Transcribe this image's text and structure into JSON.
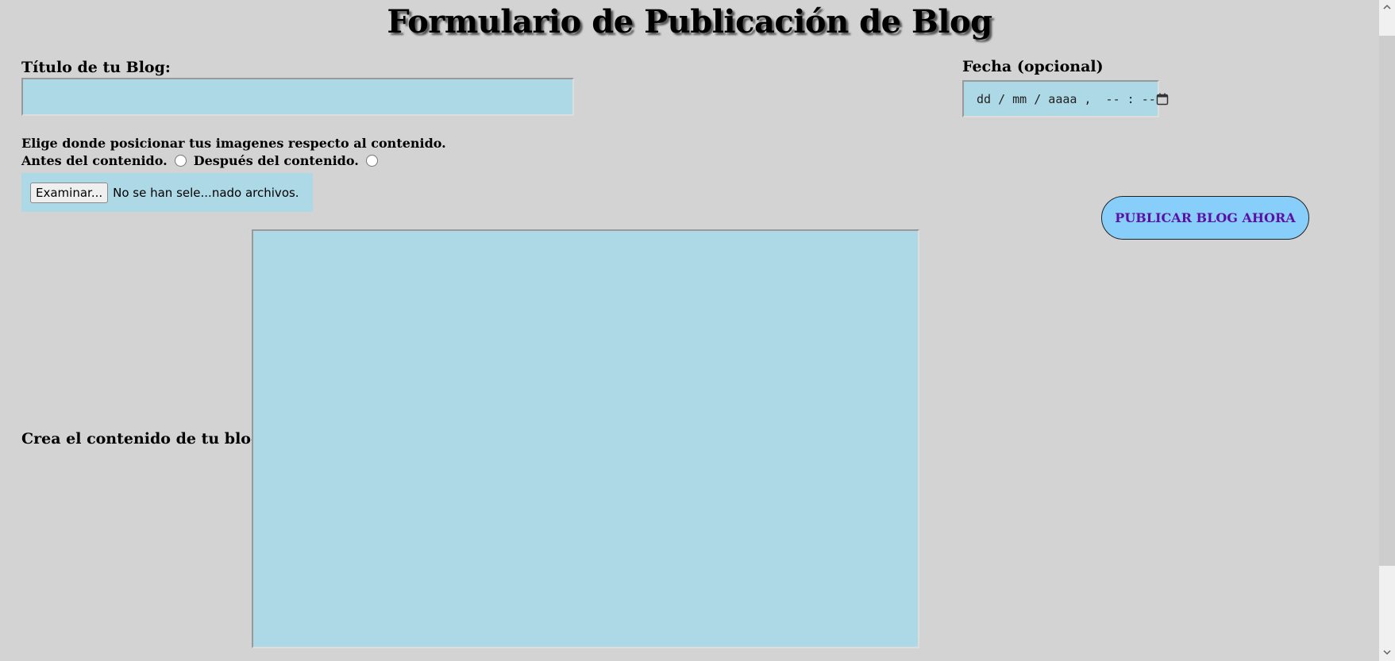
{
  "page": {
    "title": "Formulario de Publicación de Blog"
  },
  "blog_title": {
    "label": "Título de tu Blog:",
    "value": ""
  },
  "date": {
    "label": "Fecha (opcional)",
    "display": "dd / mm / aaaa ,  -- : --",
    "icon": "calendar-icon"
  },
  "image_position": {
    "prompt": "Elige donde posicionar tus imagenes respecto al contenido.",
    "options": [
      {
        "label": "Antes del contenido.",
        "checked": false
      },
      {
        "label": "Después del contenido.",
        "checked": false
      }
    ]
  },
  "file_upload": {
    "button_label": "Examinar...",
    "status": "No se han sele...nado archivos."
  },
  "publish": {
    "label": "PUBLICAR BLOG AHORA"
  },
  "content": {
    "label": "Crea el contenido de tu blog",
    "value": ""
  },
  "colors": {
    "page_background": "#d3d3d3",
    "field_background": "#add8e6",
    "publish_background": "#87cefa",
    "publish_text": "#5b0fa8"
  }
}
